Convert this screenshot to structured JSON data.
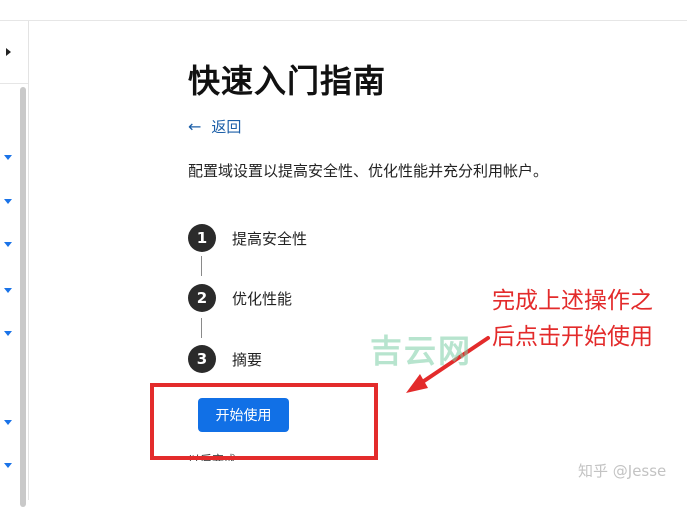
{
  "guide": {
    "title": "快速入门指南",
    "back_label": "返回",
    "description": "配置域设置以提高安全性、优化性能并充分利用帐户。",
    "steps": [
      {
        "number": "1",
        "label": "提高安全性"
      },
      {
        "number": "2",
        "label": "优化性能"
      },
      {
        "number": "3",
        "label": "摘要"
      }
    ],
    "start_button": "开始使用",
    "later_link": "以后完成"
  },
  "annotation": {
    "text": "完成上述操作之后点击开始使用",
    "color": "#e32b2b"
  },
  "watermarks": {
    "site": "吉云网",
    "credit": "知乎 @Jesse"
  },
  "colors": {
    "primary": "#1170e6",
    "link": "#1c5fa8",
    "step_circle": "#2b2b2b"
  },
  "icons": {
    "back": "arrow-left-icon",
    "nav_expand": "triangle-right-icon",
    "nav_chevron": "chevron-down-icon"
  }
}
